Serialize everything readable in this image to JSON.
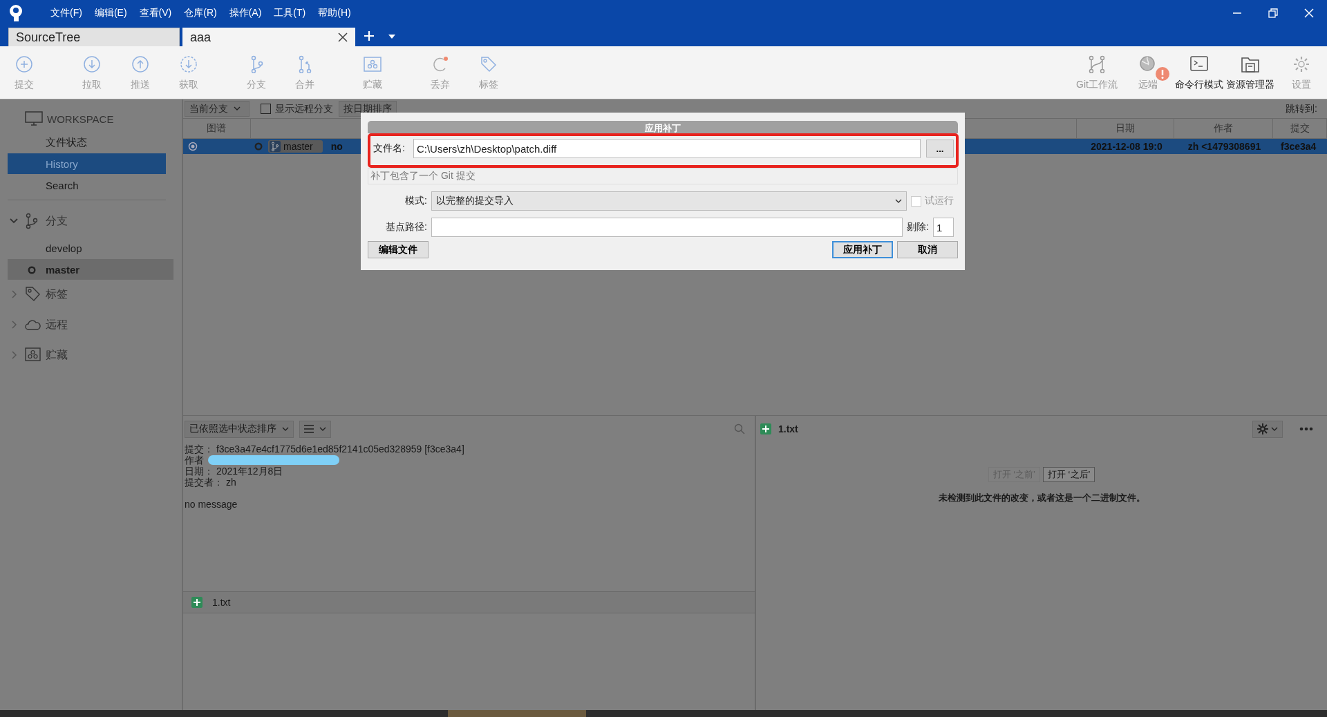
{
  "menu": [
    "文件(F)",
    "编辑(E)",
    "查看(V)",
    "仓库(R)",
    "操作(A)",
    "工具(T)",
    "帮助(H)"
  ],
  "tabs": [
    {
      "label": "SourceTree",
      "selected": false,
      "closable": false
    },
    {
      "label": "aaa",
      "selected": true,
      "closable": true
    }
  ],
  "toolbar": {
    "left_groups": [
      [
        {
          "label": "提交",
          "disabled": true
        }
      ],
      [
        {
          "label": "拉取",
          "disabled": true
        },
        {
          "label": "推送",
          "disabled": true
        },
        {
          "label": "获取",
          "disabled": true
        }
      ],
      [
        {
          "label": "分支",
          "disabled": true
        },
        {
          "label": "合并",
          "disabled": true
        }
      ],
      [
        {
          "label": "贮藏",
          "disabled": true
        }
      ],
      [
        {
          "label": "丢弃",
          "disabled": true
        },
        {
          "label": "标签",
          "disabled": true
        }
      ]
    ],
    "right": [
      {
        "label": "Git工作流",
        "disabled": true,
        "badge": false
      },
      {
        "label": "远端",
        "disabled": true,
        "badge": true
      },
      {
        "label": "命令行模式",
        "disabled": false,
        "badge": false
      },
      {
        "label": "资源管理器",
        "disabled": false,
        "badge": false
      },
      {
        "label": "设置",
        "disabled": true,
        "badge": false
      }
    ]
  },
  "sidebar": {
    "workspace": {
      "title": "WORKSPACE",
      "items": [
        {
          "label": "文件状态",
          "selected": false
        },
        {
          "label": "History",
          "selected": true
        },
        {
          "label": "Search",
          "selected": false
        }
      ]
    },
    "sections": [
      {
        "label": "分支",
        "expanded": true,
        "children": [
          {
            "label": "develop",
            "current": false
          },
          {
            "label": "master",
            "current": true
          }
        ]
      },
      {
        "label": "标签",
        "expanded": false
      },
      {
        "label": "远程",
        "expanded": false
      },
      {
        "label": "贮藏",
        "expanded": false
      }
    ]
  },
  "history": {
    "branch_filter": "当前分支",
    "show_remote": {
      "label": "显示远程分支",
      "checked": false
    },
    "sort": "按日期排序",
    "jump_label": "跳转到:",
    "columns": [
      "图谱",
      "日期",
      "作者",
      "提交"
    ],
    "rows": [
      {
        "selected": true,
        "branch": "master",
        "description": "no",
        "date": "2021-12-08 19:0",
        "author": "zh <1479308691",
        "commit": "f3ce3a4"
      }
    ]
  },
  "details": {
    "sort": "已依照选中状态排序",
    "lines": [
      "提交： f3ce3a47e4cf1775d6e1ed85f2141c05ed328959 [f3ce3a4]",
      "作者",
      "日期： 2021年12月8日",
      "提交者： zh"
    ],
    "message": "no message",
    "files": [
      {
        "name": "1.txt"
      }
    ]
  },
  "diff": {
    "file": {
      "name": "1.txt"
    },
    "buttons": [
      {
        "label": "打开 ‘之前’",
        "disabled": true
      },
      {
        "label": "打开 ‘之后’",
        "disabled": false
      }
    ],
    "message": "未检测到此文件的改变，或者这是一个二进制文件。"
  },
  "dialog": {
    "title": "应用补丁",
    "file_label": "文件名:",
    "file_value": "C:\\Users\\zh\\Desktop\\patch.diff",
    "browse": "...",
    "info": "补丁包含了一个 Git 提交",
    "mode_label": "模式:",
    "mode_value": "以完整的提交导入",
    "dry_run": {
      "label": "试运行",
      "checked": false,
      "disabled": true
    },
    "base_label": "基点路径:",
    "strip_label": "剔除:",
    "strip_value": "1",
    "buttons": [
      {
        "label": "编辑文件",
        "default": false
      },
      {
        "label": "应用补丁",
        "default": true
      },
      {
        "label": "取消",
        "default": false
      }
    ]
  }
}
